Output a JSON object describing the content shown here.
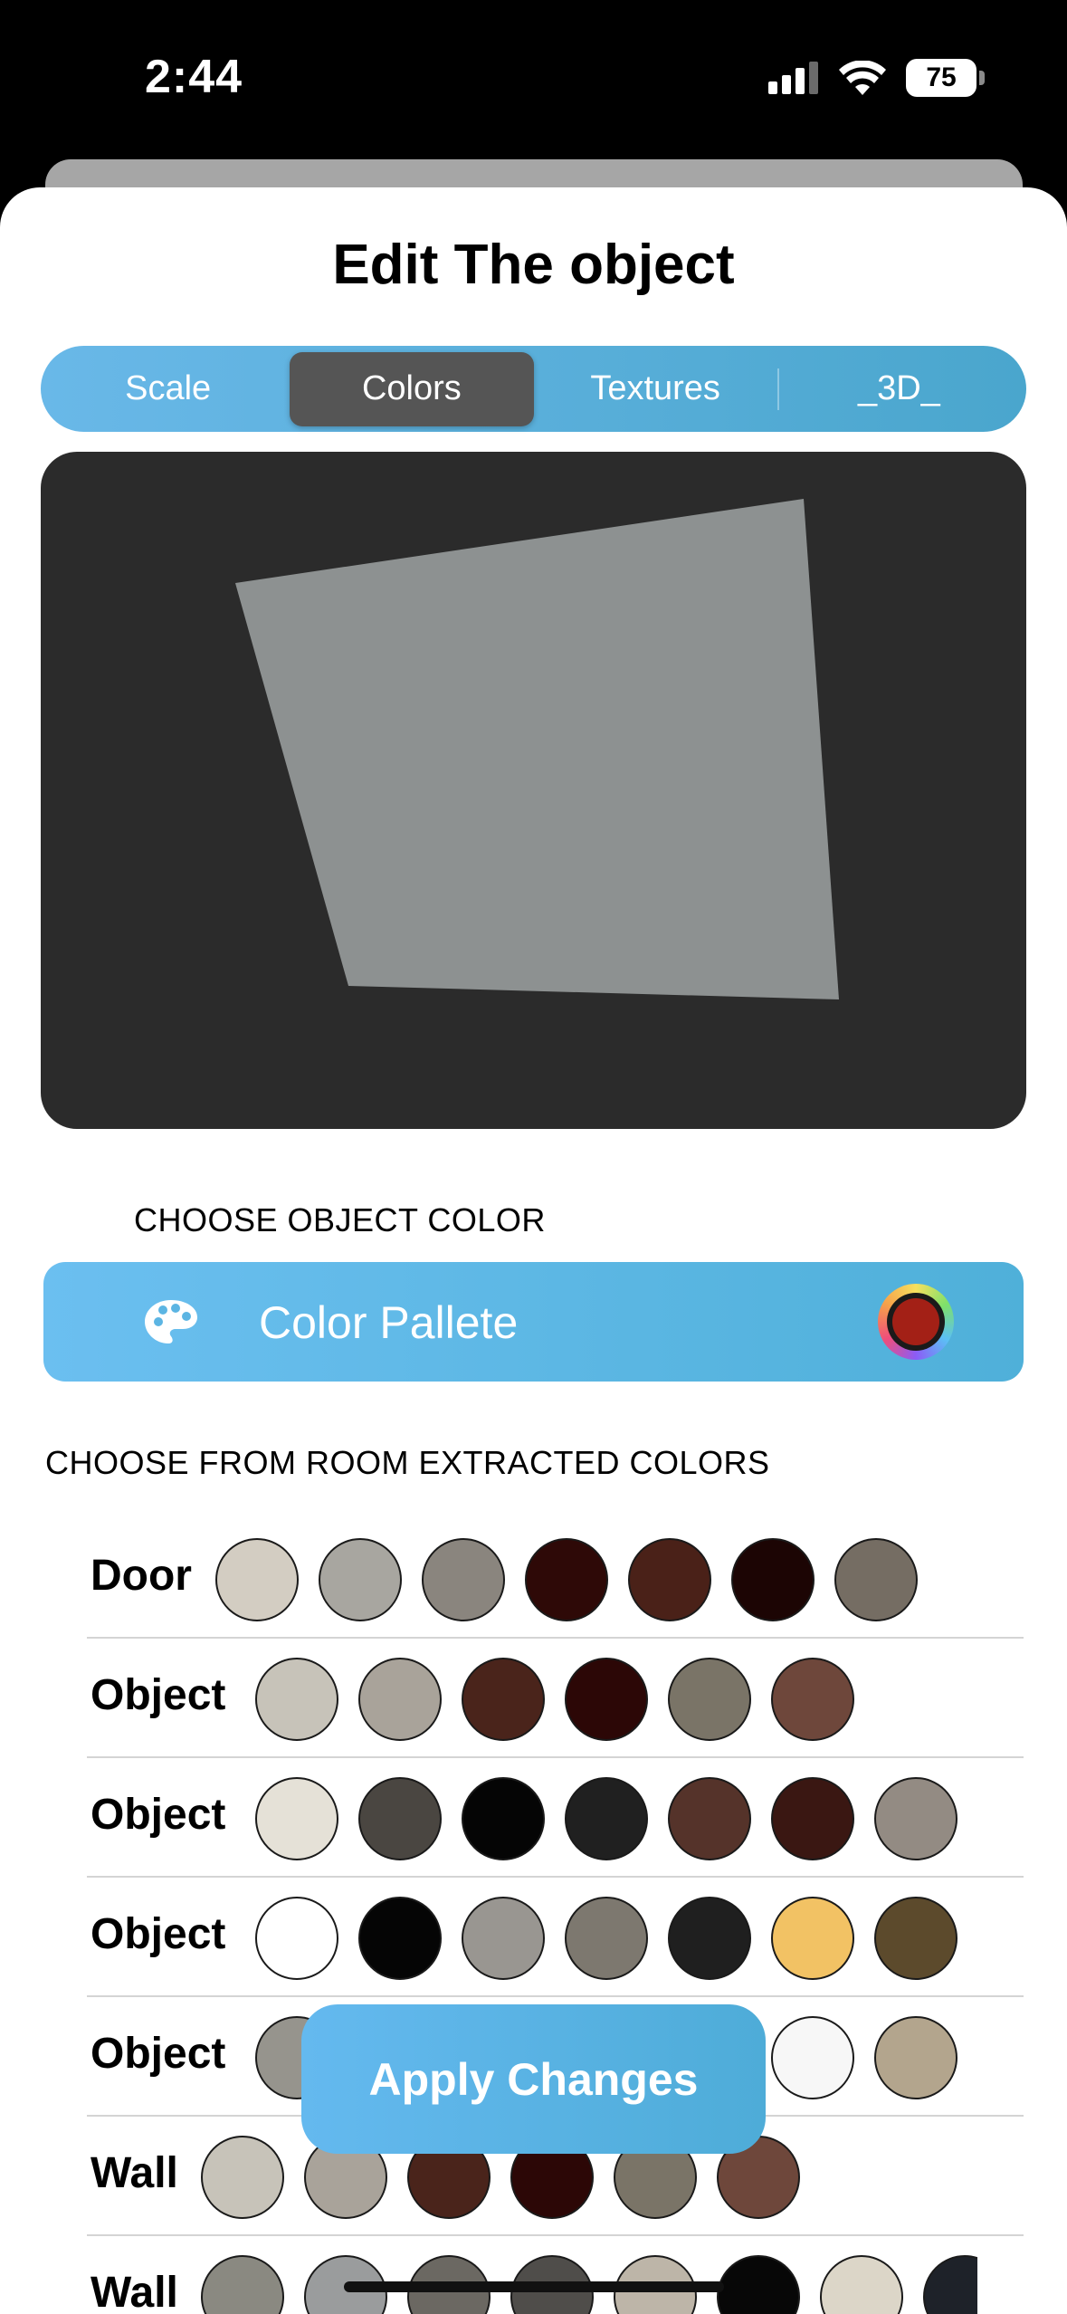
{
  "status": {
    "time": "2:44",
    "battery": "75"
  },
  "sheet": {
    "title": "Edit The object"
  },
  "tabs": [
    {
      "label": "Scale",
      "active": false
    },
    {
      "label": "Colors",
      "active": true
    },
    {
      "label": "Textures",
      "active": false
    },
    {
      "label": "_3D_",
      "active": false
    }
  ],
  "color_section": {
    "label": "CHOOSE OBJECT COLOR",
    "palette_label": "Color Pallete",
    "selected_color": "#a32016",
    "icon": "palette-icon"
  },
  "extracted": {
    "label": "CHOOSE FROM ROOM EXTRACTED COLORS",
    "rows": [
      {
        "label": "Door",
        "colors": [
          "#d3cdc2",
          "#a8a6a0",
          "#8a857e",
          "#2e0907",
          "#4a2118",
          "#1c0504",
          "#756d63"
        ]
      },
      {
        "label": "Object",
        "colors": [
          "#c7c3b9",
          "#a9a39a",
          "#4a241b",
          "#2c0706",
          "#7a7467",
          "#6e473b"
        ]
      },
      {
        "label": "Object",
        "colors": [
          "#e5e1d7",
          "#4a4641",
          "#050505",
          "#202020",
          "#55332a",
          "#3a1712",
          "#938b83",
          "#b5aea4"
        ]
      },
      {
        "label": "Object",
        "colors": [
          "#ffffff",
          "#050505",
          "#999691",
          "#7d786f",
          "#1f1f1f",
          "#f2c264",
          "#5c4a2c",
          "#c2b9a8"
        ]
      },
      {
        "label": "Object",
        "colors": [
          "#96948d",
          "#3a3a3a",
          "#2e2e2e",
          "#444",
          "#292929",
          "#f7f7f7",
          "#b3a58d",
          "#c2b9a8"
        ]
      },
      {
        "label": "Wall",
        "colors": [
          "#c7c3b9",
          "#a9a39a",
          "#4a241b",
          "#2c0706",
          "#7a7467",
          "#6e473b"
        ]
      },
      {
        "label": "Wall",
        "colors": [
          "#8a8981",
          "#9a9c9d",
          "#6b6862",
          "#4f4d4a",
          "#bdb5a8",
          "#070707",
          "#dcd6c8",
          "#1e2229"
        ]
      }
    ]
  },
  "apply_button": "Apply Changes",
  "preview": {
    "bg": "#2b2b2b",
    "shape_color": "#8d9191"
  }
}
